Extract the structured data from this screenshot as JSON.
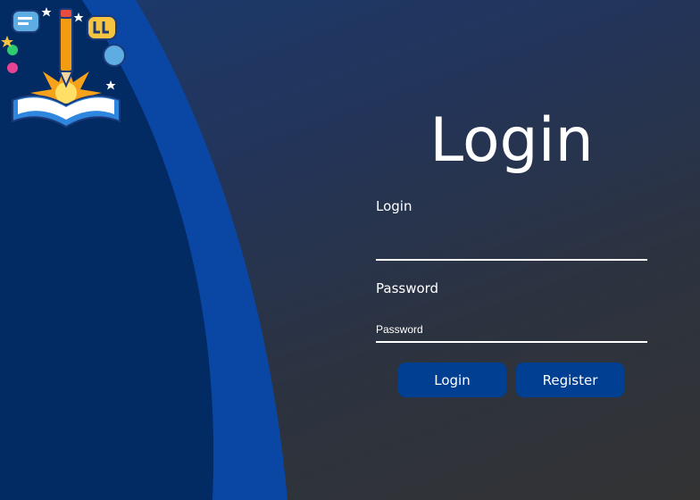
{
  "page": {
    "title": "Login"
  },
  "form": {
    "login_label": "Login",
    "login_value": "",
    "password_label": "Password",
    "password_placeholder": "Password",
    "login_button": "Login",
    "register_button": "Register"
  },
  "colors": {
    "accent_blue": "#003f91",
    "left_panel_dark": "#022a63",
    "left_panel_stripe": "#0a47a5",
    "text": "#ffffff"
  },
  "icons": {
    "logo": "open-book-pencil-chat-logo-icon"
  }
}
